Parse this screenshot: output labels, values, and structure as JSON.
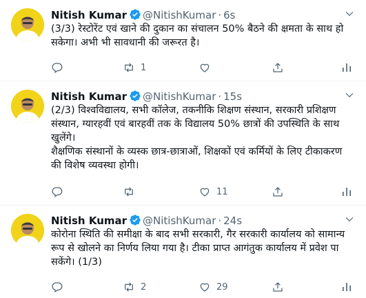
{
  "colors": {
    "text": "#0f1419",
    "secondary": "#536471",
    "verified": "#1d9bf0",
    "avatar_bg": "#f1d31a",
    "divider": "#eff3f4"
  },
  "tweets": [
    {
      "name": "Nitish Kumar",
      "handle": "@NitishKumar",
      "time": "6s",
      "lines": [
        "(3/3) रेस्टोरेंट एवं खाने की दुकान का संचालन 50% बैठने की क्षमता के साथ हो सकेगा। अभी भी सावधानी की जरूरत है।"
      ],
      "reply_count": "",
      "retweet_count": "1",
      "like_count": "",
      "icons": [
        "reply-icon",
        "retweet-icon",
        "like-icon",
        "share-icon",
        "analytics-icon"
      ]
    },
    {
      "name": "Nitish Kumar",
      "handle": "@NitishKumar",
      "time": "15s",
      "lines": [
        "(2/3) विश्वविद्यालय, सभी कॉलेज, तकनीकि शिक्षण संस्थान, सरकारी प्रशिक्षण संस्थान, ग्यारहवीं एवं बारहवीं तक के विद्यालय 50% छात्रों की उपस्थिति के साथ खुलेंगे।",
        "शैक्षणिक संस्थानों के व्यस्क छात्र-छात्राओं, शिक्षकों एवं कर्मियों के लिए टीकाकरण की विशेष व्यवस्था होगी।"
      ],
      "reply_count": "",
      "retweet_count": "",
      "like_count": "11",
      "icons": [
        "reply-icon",
        "retweet-icon",
        "like-icon",
        "share-icon",
        "analytics-icon"
      ]
    },
    {
      "name": "Nitish Kumar",
      "handle": "@NitishKumar",
      "time": "24s",
      "lines": [
        "कोरोना स्थिति की समीक्षा के बाद सभी सरकारी, गैर सरकारी कार्यालय को सामान्य रूप से खोलने का निर्णय लिया गया है। टीका प्राप्त आगंतुक कार्यालय में प्रवेश पा सकेंगे। (1/3)"
      ],
      "reply_count": "",
      "retweet_count": "2",
      "like_count": "29",
      "icons": [
        "reply-icon",
        "retweet-icon",
        "like-icon",
        "share-icon",
        "analytics-icon"
      ]
    }
  ]
}
